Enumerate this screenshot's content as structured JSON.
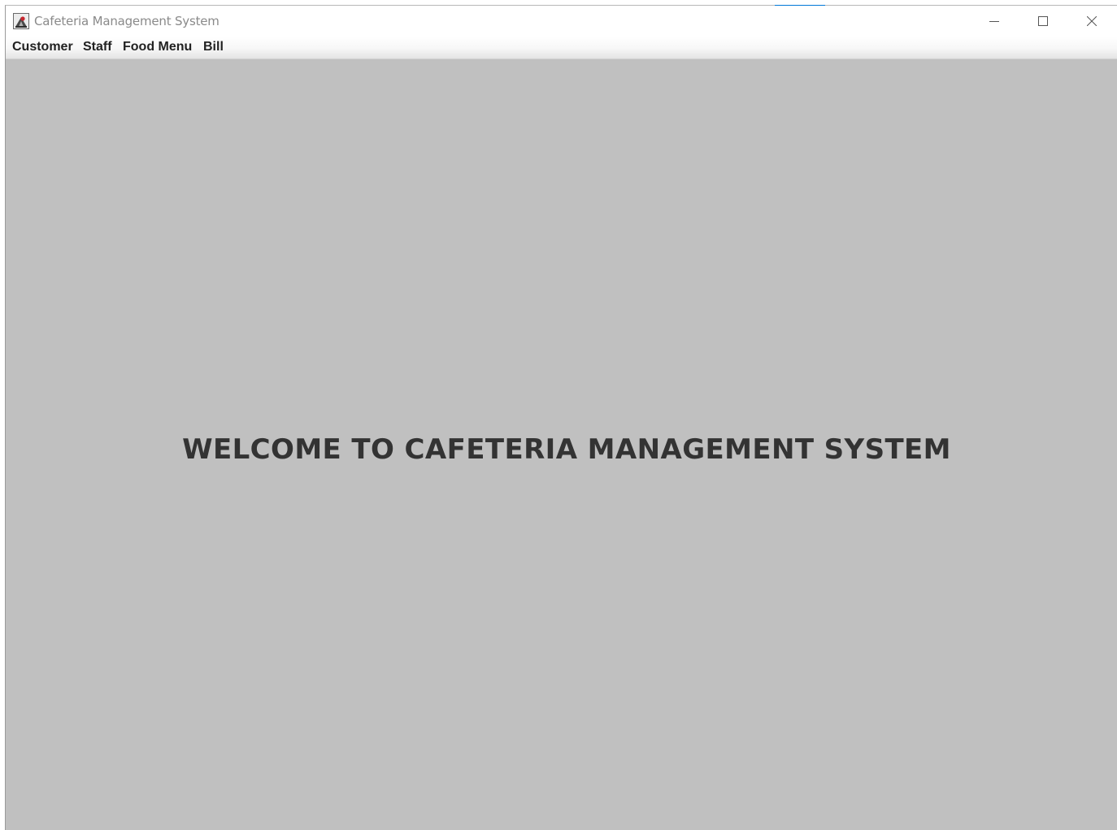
{
  "window": {
    "title": "Cafeteria Management System",
    "controls": {
      "minimize": "minimize-icon",
      "maximize": "maximize-icon",
      "close": "close-icon"
    }
  },
  "menubar": {
    "items": [
      {
        "label": "Customer"
      },
      {
        "label": "Staff"
      },
      {
        "label": "Food Menu"
      },
      {
        "label": "Bill"
      }
    ]
  },
  "main": {
    "welcome_text": "WELCOME TO CAFETERIA MANAGEMENT SYSTEM"
  },
  "colors": {
    "content_background": "#c0c0c0",
    "welcome_text": "#333333",
    "title_text": "#8a8a8a",
    "accent": "#0078d7"
  }
}
